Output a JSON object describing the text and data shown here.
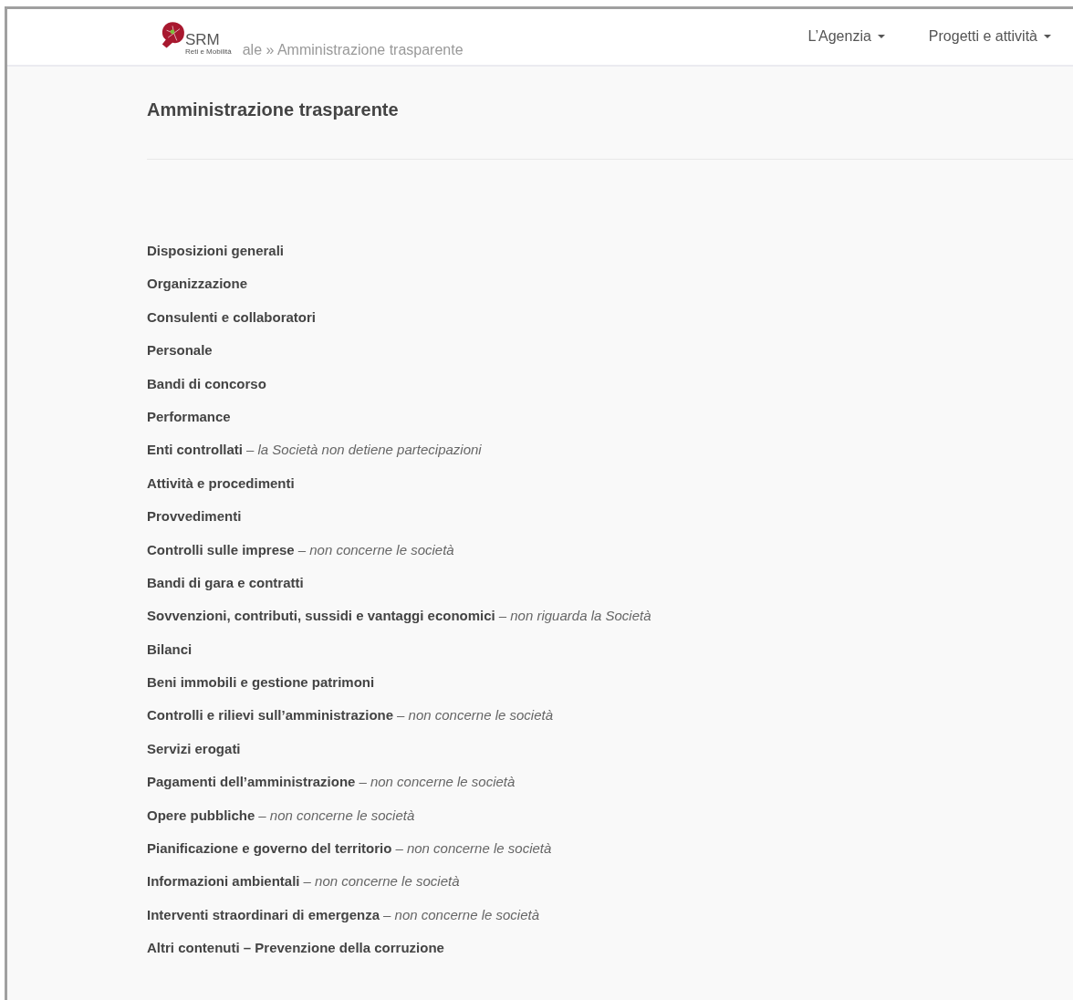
{
  "header": {
    "logo": {
      "name": "SRM",
      "tagline": "Reti e Mobilità"
    },
    "breadcrumb": "ale » Amministrazione trasparente",
    "nav": [
      {
        "label": "L’Agenzia"
      },
      {
        "label": "Progetti e attività"
      }
    ]
  },
  "page": {
    "title": "Amministrazione trasparente",
    "sections": [
      {
        "label": "Disposizioni generali"
      },
      {
        "label": "Organizzazione"
      },
      {
        "label": "Consulenti e collaboratori"
      },
      {
        "label": "Personale"
      },
      {
        "label": "Bandi di concorso"
      },
      {
        "label": "Performance"
      },
      {
        "label": "Enti controllati",
        "note": "– la Società non detiene partecipazioni"
      },
      {
        "label": "Attività e procedimenti"
      },
      {
        "label": "Provvedimenti"
      },
      {
        "label": "Controlli sulle imprese",
        "note": "– non concerne le società"
      },
      {
        "label": "Bandi di gara e contratti"
      },
      {
        "label": "Sovvenzioni, contributi, sussidi e vantaggi economici",
        "note": "– non riguarda la Società"
      },
      {
        "label": "Bilanci"
      },
      {
        "label": "Beni immobili e gestione patrimoni"
      },
      {
        "label": "Controlli e rilievi sull’amministrazione",
        "note": "– non concerne le società"
      },
      {
        "label": "Servizi erogati"
      },
      {
        "label": "Pagamenti dell’amministrazione",
        "note": "– non concerne le società"
      },
      {
        "label": "Opere pubbliche",
        "note": "– non concerne le società"
      },
      {
        "label": "Pianificazione e governo del territorio",
        "note": "– non concerne le società"
      },
      {
        "label": "Informazioni ambientali",
        "note": "– non concerne le società"
      },
      {
        "label": "Interventi straordinari di emergenza",
        "note": "– non concerne le società"
      },
      {
        "label": "Altri contenuti – Prevenzione della corruzione"
      }
    ]
  }
}
